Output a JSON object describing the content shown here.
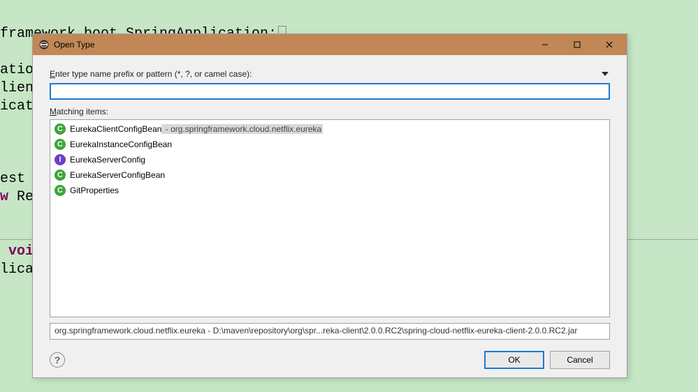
{
  "background_code": {
    "line1": "framework.boot.SpringApplication;",
    "line2": "",
    "line3": "atio",
    "line4": "lien",
    "line5": "icat",
    "line6": "",
    "line7": "",
    "line8": "",
    "line9": "est",
    "line10_kw": "w",
    "line10_rest": " Re",
    "line11": "",
    "line12": "",
    "line13_kw": " voi",
    "line14": "lica"
  },
  "dialog": {
    "title": "Open Type",
    "prompt_pre": "E",
    "prompt_rest": "nter type name prefix or pattern (*, ?, or camel case):",
    "input_value": "",
    "matching_pre": "M",
    "matching_rest": "atching items:",
    "items": [
      {
        "icon": "class",
        "name": "EurekaClientConfigBean",
        "sub": " - org.springframework.cloud.netflix.eureka",
        "selected": true
      },
      {
        "icon": "class",
        "name": "EurekaInstanceConfigBean",
        "sub": "",
        "selected": false
      },
      {
        "icon": "interface",
        "name": "EurekaServerConfig",
        "sub": "",
        "selected": false
      },
      {
        "icon": "class",
        "name": "EurekaServerConfigBean",
        "sub": "",
        "selected": false
      },
      {
        "icon": "class",
        "name": "GitProperties",
        "sub": "",
        "selected": false
      }
    ],
    "status": "org.springframework.cloud.netflix.eureka - D:\\maven\\repository\\org\\spr...reka-client\\2.0.0.RC2\\spring-cloud-netflix-eureka-client-2.0.0.RC2.jar",
    "ok_label": "OK",
    "cancel_label": "Cancel"
  }
}
